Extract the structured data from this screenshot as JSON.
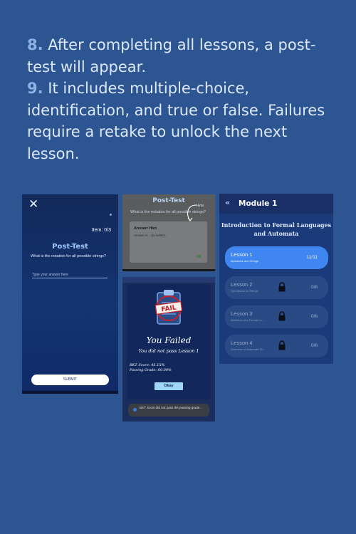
{
  "instructions": [
    {
      "num": "8.",
      "text": " After completing all lessons, a post-test will appear."
    },
    {
      "num": "9.",
      "text": " It includes multiple-choice, identification, and true or false. Failures require a retake to unlock the next lesson."
    }
  ],
  "post_test": {
    "close_icon": "close-icon",
    "item": "Item: 0/3",
    "title": "Post-Test",
    "question": "What is the notation for all possible strings?",
    "answer_placeholder": "Type your answer here",
    "submit": "SUBMIT"
  },
  "hint_screen": {
    "title": "Post-Test",
    "hint_mark": "Hints",
    "question": "What is the notation for all possible strings?",
    "dialog_title": "Answer Hint",
    "dialog_body": "Answer is ...(is notatio..",
    "ok": "OK"
  },
  "failed_screen": {
    "heading": "You Failed",
    "subheading": "You did not pass Lesson 1",
    "bkt_score": "BKT Score: 45.15%",
    "passing_grade": "Passing Grade: 60.00%",
    "okay": "Okay",
    "toast": "BKT Score did not pass the passing grade...",
    "stamp": "FAIL"
  },
  "module": {
    "back_icon": "double-chevron-left-icon",
    "title": "Module 1",
    "subtitle": "Introduction to Formal Languages and Automata",
    "lessons": [
      {
        "name": "Lesson 1",
        "desc": "Alphabets and Strings",
        "progress": "11/11",
        "locked": false
      },
      {
        "name": "Lesson 2",
        "desc": "Operations on Strings",
        "progress": "0/6",
        "locked": true
      },
      {
        "name": "Lesson 3",
        "desc": "Definition of a Formal La...",
        "progress": "0/6",
        "locked": true
      },
      {
        "name": "Lesson 4",
        "desc": "Overview of Automata Th...",
        "progress": "0/6",
        "locked": true
      }
    ]
  }
}
